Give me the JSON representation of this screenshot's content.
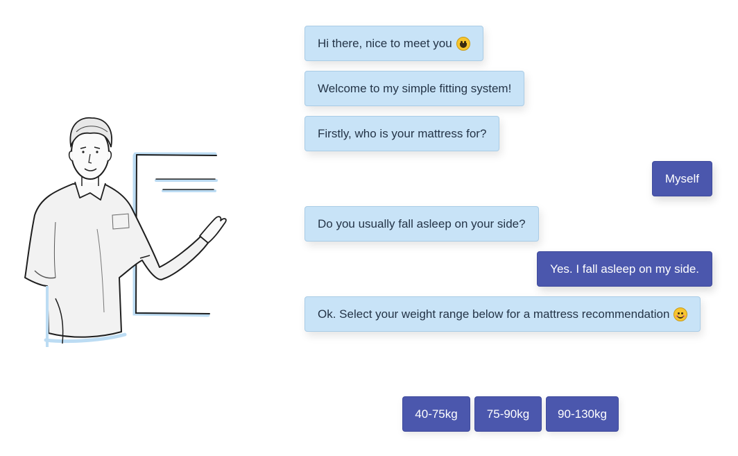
{
  "messages": {
    "m1": "Hi there, nice to meet you",
    "m2": "Welcome to my simple fitting system!",
    "m3": "Firstly, who is your mattress for?",
    "r1": "Myself",
    "m4": "Do you usually fall asleep on your side?",
    "r2": "Yes. I fall asleep on my side.",
    "m5": "Ok. Select your weight range below for a mattress recommendation"
  },
  "options": [
    "40-75kg",
    "75-90kg",
    "90-130kg"
  ],
  "icons": {
    "m1": "grinning-face-emoji-icon",
    "m5": "smiling-face-emoji-icon"
  },
  "colors": {
    "bot_bubble": "#c8e3f7",
    "user_bubble": "#4b57ad",
    "bot_text": "#243447"
  }
}
